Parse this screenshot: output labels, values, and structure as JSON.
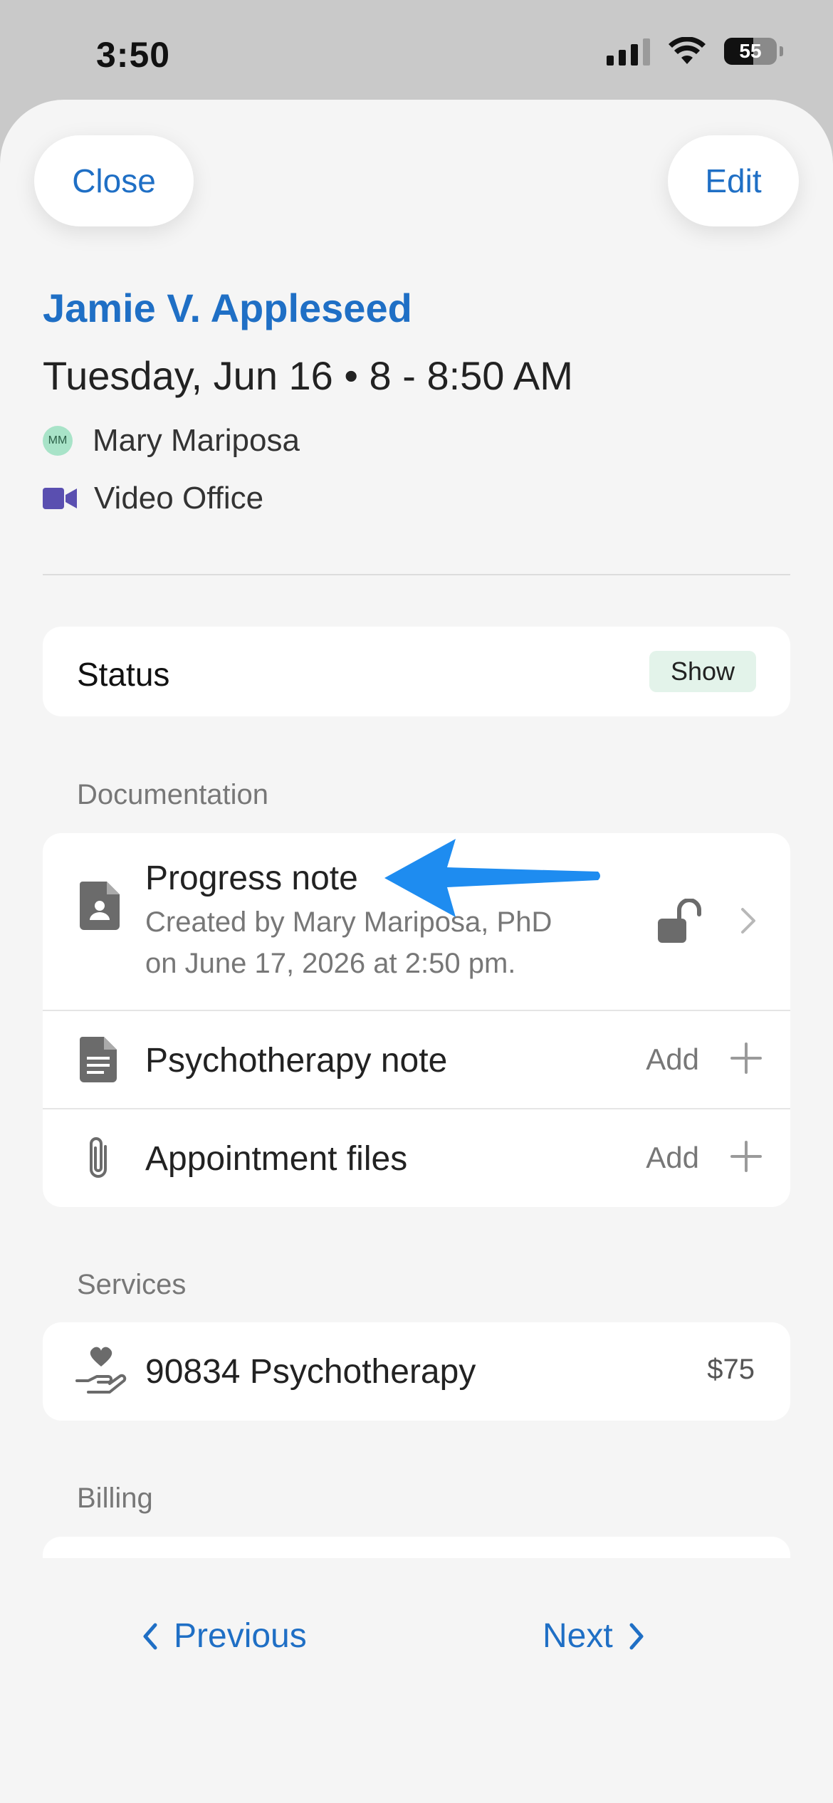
{
  "status_bar": {
    "time": "3:50",
    "battery": "55"
  },
  "header": {
    "close_label": "Close",
    "edit_label": "Edit"
  },
  "appointment": {
    "client_name": "Jamie V. Appleseed",
    "datetime": "Tuesday, Jun 16 • 8 - 8:50 AM",
    "clinician_initials": "MM",
    "clinician": "Mary Mariposa",
    "location": "Video Office"
  },
  "status": {
    "label": "Status",
    "value": "Show"
  },
  "documentation": {
    "section_label": "Documentation",
    "progress_note": {
      "title": "Progress note",
      "line1": "Created by Mary Mariposa, PhD",
      "line2": "on June 17, 2026 at 2:50 pm."
    },
    "psychotherapy_note": {
      "title": "Psychotherapy note",
      "action": "Add"
    },
    "appointment_files": {
      "title": "Appointment files",
      "action": "Add"
    }
  },
  "services": {
    "section_label": "Services",
    "items": [
      {
        "name": "90834 Psychotherapy",
        "price": "$75"
      }
    ]
  },
  "billing": {
    "section_label": "Billing"
  },
  "footer": {
    "previous_label": "Previous",
    "next_label": "Next"
  },
  "colors": {
    "accent": "#1f6fc5",
    "annotation_arrow": "#1e8cf0",
    "video": "#5a4fb0",
    "status_badge_bg": "#e3f3ea"
  }
}
